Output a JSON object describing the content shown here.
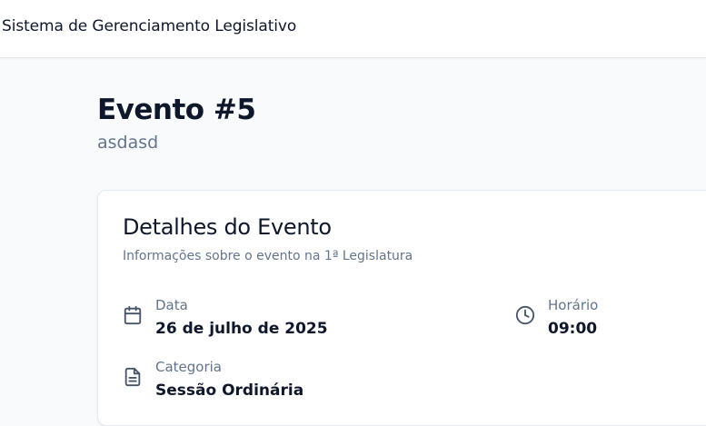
{
  "header": {
    "app_title": "Sistema de Gerenciamento Legislativo"
  },
  "page": {
    "title": "Evento #5",
    "subtitle": "asdasd"
  },
  "card": {
    "title": "Detalhes do Evento",
    "description": "Informações sobre o evento na 1ª Legislatura",
    "fields": {
      "date": {
        "label": "Data",
        "value": "26 de julho de 2025",
        "icon": "calendar-icon"
      },
      "time": {
        "label": "Horário",
        "value": "09:00",
        "icon": "clock-icon"
      },
      "category": {
        "label": "Categoria",
        "value": "Sessão Ordinária",
        "icon": "document-icon"
      }
    }
  },
  "colors": {
    "muted_text": "#64748b",
    "primary_text": "#0f172a",
    "border": "#e2e8f0"
  }
}
